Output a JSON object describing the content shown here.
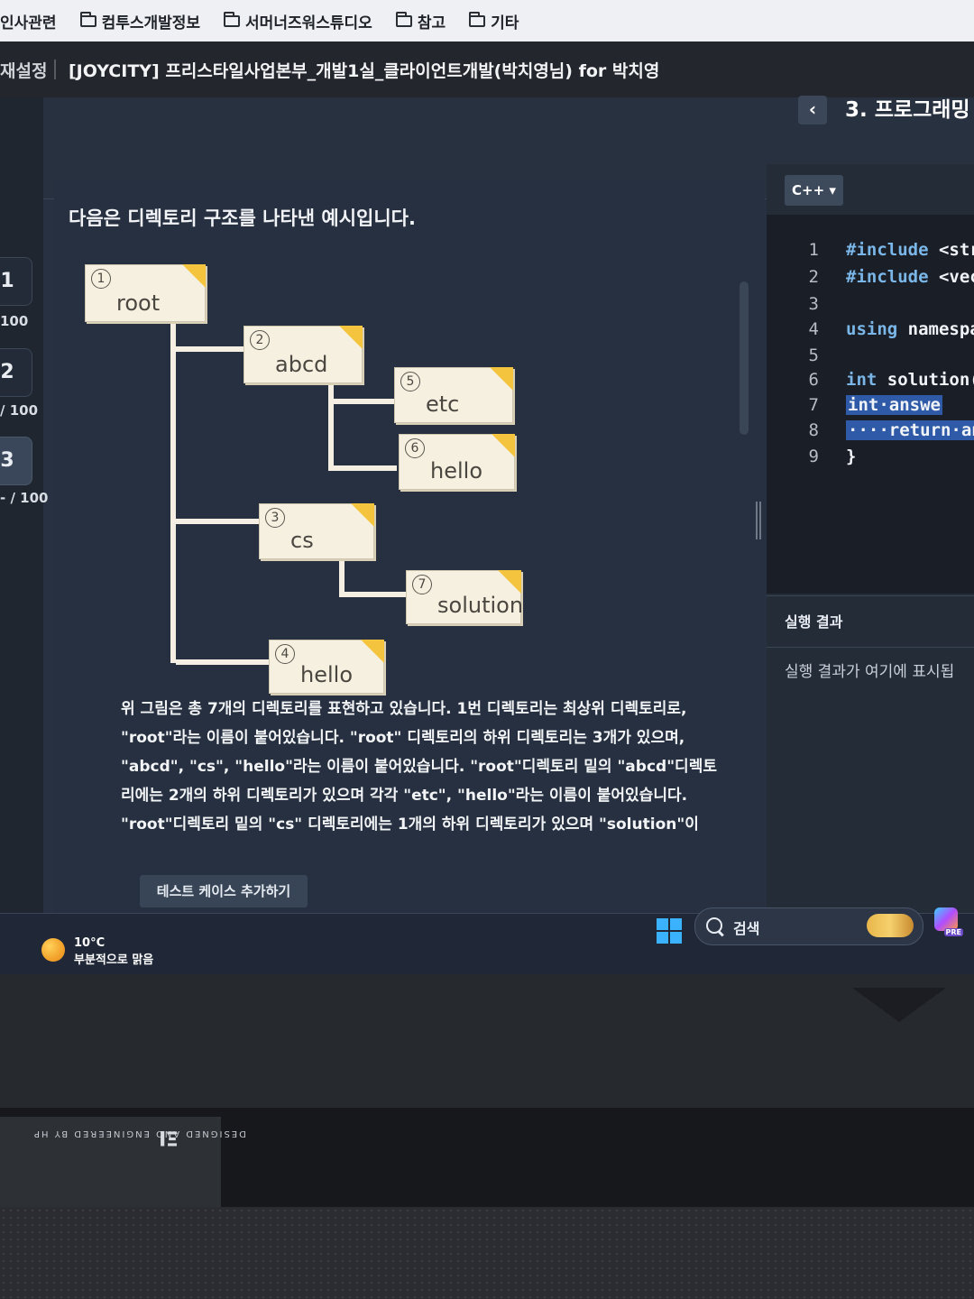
{
  "bookmarks": [
    "인사관련",
    "컴투스개발정보",
    "서머너즈워스튜디오",
    "참고",
    "기타"
  ],
  "titlebar": {
    "left_label": "재설정",
    "title": "[JOYCITY] 프리스타일사업본부_개발1실_클라이언트개발(박치영님) for 박치영"
  },
  "rail": {
    "items": [
      {
        "label": "1",
        "score": "100"
      },
      {
        "label": "2",
        "score": "/ 100"
      },
      {
        "label": "3",
        "score": "- / 100"
      }
    ]
  },
  "problem": {
    "title": "3. 프로그래밍 (-",
    "back_icon": "chevron-left-icon",
    "intro": "다음은 디렉토리 구조를 나타낸 예시입니다.",
    "nodes": [
      {
        "num": "1",
        "name": "root"
      },
      {
        "num": "2",
        "name": "abcd"
      },
      {
        "num": "5",
        "name": "etc"
      },
      {
        "num": "6",
        "name": "hello"
      },
      {
        "num": "3",
        "name": "cs"
      },
      {
        "num": "7",
        "name": "solution"
      },
      {
        "num": "4",
        "name": "hello"
      }
    ],
    "body": [
      "위 그림은 총 7개의 디렉토리를 표현하고 있습니다. 1번 디렉토리는 최상위 디렉토리로,",
      "\"root\"라는 이름이 붙어있습니다. \"root\" 디렉토리의 하위 디렉토리는 3개가 있으며,",
      "\"abcd\", \"cs\", \"hello\"라는 이름이 붙어있습니다. \"root\"디렉토리 밑의 \"abcd\"디렉토",
      "리에는 2개의 하위 디렉토리가 있으며 각각 \"etc\", \"hello\"라는 이름이 붙어있습니다.",
      "\"root\"디렉토리 밑의 \"cs\" 디렉토리에는 1개의 하위 디렉토리가 있으며 \"solution\"이"
    ],
    "add_test_label": "테스트 케이스 추가하기"
  },
  "editor": {
    "language": "C++",
    "lines": [
      {
        "n": "1",
        "kw": "#include",
        "txt": " <str"
      },
      {
        "n": "2",
        "kw": "#include",
        "txt": " <vec"
      },
      {
        "n": "3",
        "kw": "",
        "txt": ""
      },
      {
        "n": "4",
        "kw": "using",
        "txt": " namespa"
      },
      {
        "n": "5",
        "kw": "",
        "txt": ""
      },
      {
        "n": "6",
        "kw": "int",
        "txt": " solution("
      },
      {
        "n": "7",
        "kw": "",
        "txt": "int·answe"
      },
      {
        "n": "8",
        "kw": "",
        "txt": "····return·an"
      },
      {
        "n": "9",
        "kw": "",
        "txt": "}"
      }
    ]
  },
  "result": {
    "title": "실행 결과",
    "placeholder": "실행 결과가 여기에 표시됩"
  },
  "taskbar": {
    "temperature": "10°C",
    "condition": "부분적으로 맑음",
    "search_label": "검색",
    "copilot_badge": "PRE"
  },
  "laptop": {
    "badge_text": "DESIGNED AND ENGINEERED BY HP",
    "badge_logo": "ΞI"
  }
}
